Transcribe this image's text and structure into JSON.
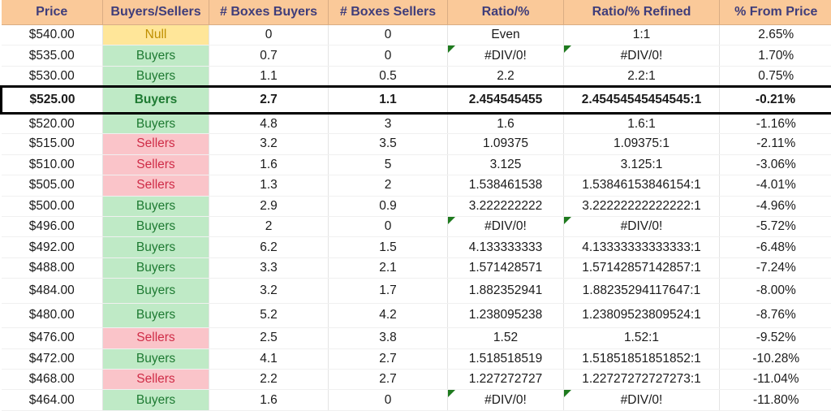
{
  "table": {
    "columns": [
      {
        "key": "price",
        "label": "Price"
      },
      {
        "key": "bs",
        "label": "Buyers/Sellers"
      },
      {
        "key": "boxes_buy",
        "label": "# Boxes Buyers"
      },
      {
        "key": "boxes_sell",
        "label": "# Boxes Sellers"
      },
      {
        "key": "ratio",
        "label": "Ratio/%"
      },
      {
        "key": "ratio_ref",
        "label": "Ratio/% Refined"
      },
      {
        "key": "pct",
        "label": "% From Price"
      }
    ],
    "colors": {
      "header_bg": "#fac999",
      "header_text": "#3f3d7a",
      "buyers_bg": "#bfeac6",
      "buyers_text": "#1e7a32",
      "sellers_bg": "#fac4c9",
      "sellers_text": "#cf2c47",
      "null_bg": "#ffe699",
      "null_text": "#bf8f00",
      "comment_flag": "#1e7a1e",
      "highlight_border": "#000000"
    },
    "rows": [
      {
        "price": "$540.00",
        "bs": "Null",
        "bs_state": "null",
        "boxes_buy": "0",
        "boxes_sell": "0",
        "ratio": "Even",
        "ratio_flag": false,
        "ratio_ref": "1:1",
        "ratio_ref_flag": false,
        "pct": "2.65%",
        "highlight": false,
        "tall": false
      },
      {
        "price": "$535.00",
        "bs": "Buyers",
        "bs_state": "buyers",
        "boxes_buy": "0.7",
        "boxes_sell": "0",
        "ratio": "#DIV/0!",
        "ratio_flag": true,
        "ratio_ref": "#DIV/0!",
        "ratio_ref_flag": true,
        "pct": "1.70%",
        "highlight": false,
        "tall": false
      },
      {
        "price": "$530.00",
        "bs": "Buyers",
        "bs_state": "buyers",
        "boxes_buy": "1.1",
        "boxes_sell": "0.5",
        "ratio": "2.2",
        "ratio_flag": false,
        "ratio_ref": "2.2:1",
        "ratio_ref_flag": false,
        "pct": "0.75%",
        "highlight": false,
        "tall": false
      },
      {
        "price": "$525.00",
        "bs": "Buyers",
        "bs_state": "buyers",
        "boxes_buy": "2.7",
        "boxes_sell": "1.1",
        "ratio": "2.454545455",
        "ratio_flag": false,
        "ratio_ref": "2.45454545454545:1",
        "ratio_ref_flag": false,
        "pct": "-0.21%",
        "highlight": true,
        "tall": false
      },
      {
        "price": "$520.00",
        "bs": "Buyers",
        "bs_state": "buyers",
        "boxes_buy": "4.8",
        "boxes_sell": "3",
        "ratio": "1.6",
        "ratio_flag": false,
        "ratio_ref": "1.6:1",
        "ratio_ref_flag": false,
        "pct": "-1.16%",
        "highlight": false,
        "tall": false
      },
      {
        "price": "$515.00",
        "bs": "Sellers",
        "bs_state": "sellers",
        "boxes_buy": "3.2",
        "boxes_sell": "3.5",
        "ratio": "1.09375",
        "ratio_flag": false,
        "ratio_ref": "1.09375:1",
        "ratio_ref_flag": false,
        "pct": "-2.11%",
        "highlight": false,
        "tall": false
      },
      {
        "price": "$510.00",
        "bs": "Sellers",
        "bs_state": "sellers",
        "boxes_buy": "1.6",
        "boxes_sell": "5",
        "ratio": "3.125",
        "ratio_flag": false,
        "ratio_ref": "3.125:1",
        "ratio_ref_flag": false,
        "pct": "-3.06%",
        "highlight": false,
        "tall": false
      },
      {
        "price": "$505.00",
        "bs": "Sellers",
        "bs_state": "sellers",
        "boxes_buy": "1.3",
        "boxes_sell": "2",
        "ratio": "1.538461538",
        "ratio_flag": false,
        "ratio_ref": "1.53846153846154:1",
        "ratio_ref_flag": false,
        "pct": "-4.01%",
        "highlight": false,
        "tall": false
      },
      {
        "price": "$500.00",
        "bs": "Buyers",
        "bs_state": "buyers",
        "boxes_buy": "2.9",
        "boxes_sell": "0.9",
        "ratio": "3.222222222",
        "ratio_flag": false,
        "ratio_ref": "3.22222222222222:1",
        "ratio_ref_flag": false,
        "pct": "-4.96%",
        "highlight": false,
        "tall": false
      },
      {
        "price": "$496.00",
        "bs": "Buyers",
        "bs_state": "buyers",
        "boxes_buy": "2",
        "boxes_sell": "0",
        "ratio": "#DIV/0!",
        "ratio_flag": true,
        "ratio_ref": "#DIV/0!",
        "ratio_ref_flag": true,
        "pct": "-5.72%",
        "highlight": false,
        "tall": false
      },
      {
        "price": "$492.00",
        "bs": "Buyers",
        "bs_state": "buyers",
        "boxes_buy": "6.2",
        "boxes_sell": "1.5",
        "ratio": "4.133333333",
        "ratio_flag": false,
        "ratio_ref": "4.13333333333333:1",
        "ratio_ref_flag": false,
        "pct": "-6.48%",
        "highlight": false,
        "tall": false
      },
      {
        "price": "$488.00",
        "bs": "Buyers",
        "bs_state": "buyers",
        "boxes_buy": "3.3",
        "boxes_sell": "2.1",
        "ratio": "1.571428571",
        "ratio_flag": false,
        "ratio_ref": "1.57142857142857:1",
        "ratio_ref_flag": false,
        "pct": "-7.24%",
        "highlight": false,
        "tall": false
      },
      {
        "price": "$484.00",
        "bs": "Buyers",
        "bs_state": "buyers",
        "boxes_buy": "3.2",
        "boxes_sell": "1.7",
        "ratio": "1.882352941",
        "ratio_flag": false,
        "ratio_ref": "1.88235294117647:1",
        "ratio_ref_flag": false,
        "pct": "-8.00%",
        "highlight": false,
        "tall": true
      },
      {
        "price": "$480.00",
        "bs": "Buyers",
        "bs_state": "buyers",
        "boxes_buy": "5.2",
        "boxes_sell": "4.2",
        "ratio": "1.238095238",
        "ratio_flag": false,
        "ratio_ref": "1.23809523809524:1",
        "ratio_ref_flag": false,
        "pct": "-8.76%",
        "highlight": false,
        "tall": true
      },
      {
        "price": "$476.00",
        "bs": "Sellers",
        "bs_state": "sellers",
        "boxes_buy": "2.5",
        "boxes_sell": "3.8",
        "ratio": "1.52",
        "ratio_flag": false,
        "ratio_ref": "1.52:1",
        "ratio_ref_flag": false,
        "pct": "-9.52%",
        "highlight": false,
        "tall": false
      },
      {
        "price": "$472.00",
        "bs": "Buyers",
        "bs_state": "buyers",
        "boxes_buy": "4.1",
        "boxes_sell": "2.7",
        "ratio": "1.518518519",
        "ratio_flag": false,
        "ratio_ref": "1.51851851851852:1",
        "ratio_ref_flag": false,
        "pct": "-10.28%",
        "highlight": false,
        "tall": false
      },
      {
        "price": "$468.00",
        "bs": "Sellers",
        "bs_state": "sellers",
        "boxes_buy": "2.2",
        "boxes_sell": "2.7",
        "ratio": "1.227272727",
        "ratio_flag": false,
        "ratio_ref": "1.22727272727273:1",
        "ratio_ref_flag": false,
        "pct": "-11.04%",
        "highlight": false,
        "tall": false
      },
      {
        "price": "$464.00",
        "bs": "Buyers",
        "bs_state": "buyers",
        "boxes_buy": "1.6",
        "boxes_sell": "0",
        "ratio": "#DIV/0!",
        "ratio_flag": true,
        "ratio_ref": "#DIV/0!",
        "ratio_ref_flag": true,
        "pct": "-11.80%",
        "highlight": false,
        "tall": false
      }
    ]
  }
}
